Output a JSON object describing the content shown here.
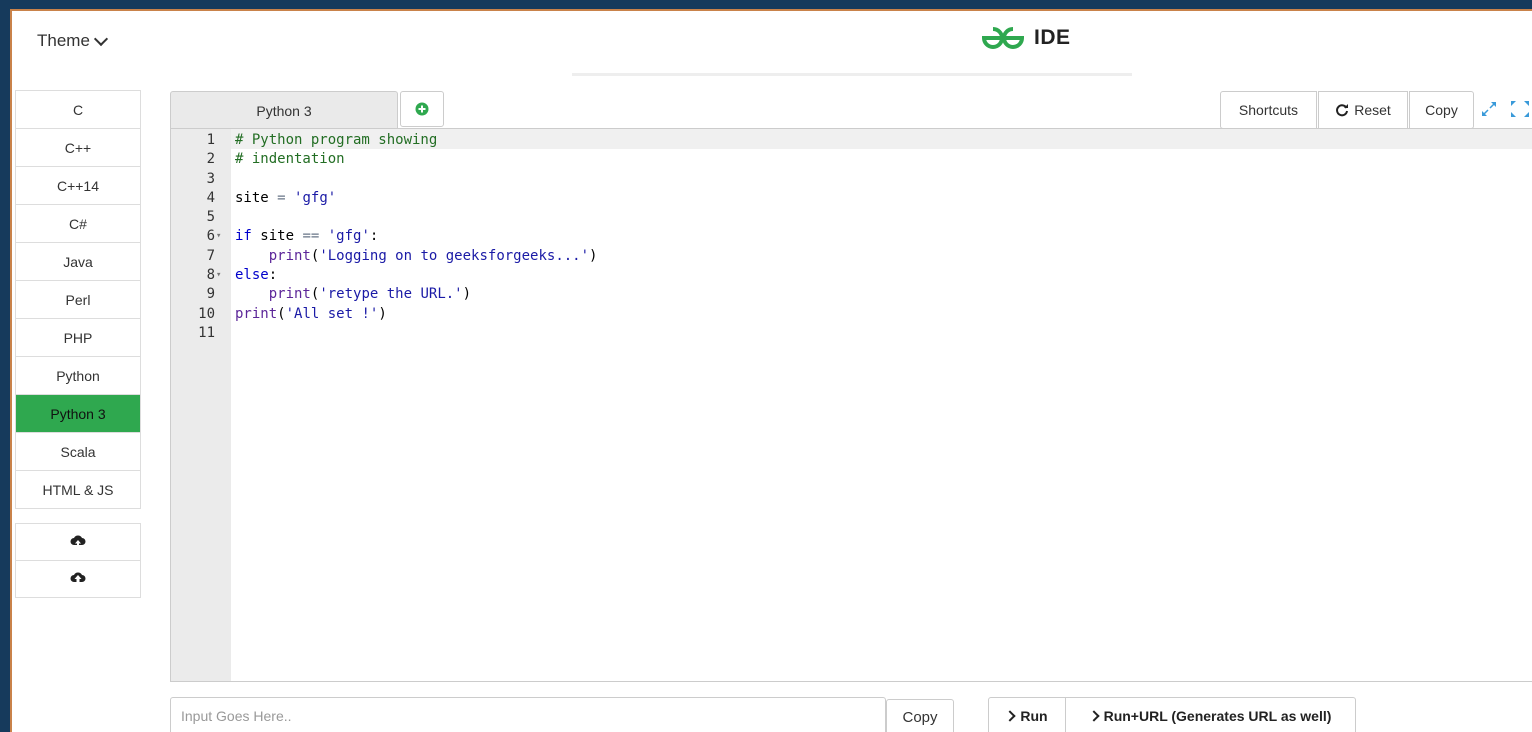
{
  "header": {
    "theme_label": "Theme",
    "logo_text": "IDE",
    "brand_color": "#2fa84f"
  },
  "sidebar": {
    "languages": [
      {
        "label": "C"
      },
      {
        "label": "C++"
      },
      {
        "label": "C++14"
      },
      {
        "label": "C#"
      },
      {
        "label": "Java"
      },
      {
        "label": "Perl"
      },
      {
        "label": "PHP"
      },
      {
        "label": "Python"
      },
      {
        "label": "Python 3",
        "active": true
      },
      {
        "label": "Scala"
      },
      {
        "label": "HTML & JS"
      }
    ],
    "cloud_buttons": [
      {
        "icon": "cloud-upload-icon"
      },
      {
        "icon": "cloud-download-icon"
      }
    ]
  },
  "editor_toolbar": {
    "tab_label": "Python 3",
    "shortcuts_label": "Shortcuts",
    "reset_label": "Reset",
    "copy_label": "Copy"
  },
  "editor": {
    "lines": [
      {
        "n": "1",
        "text": "# Python program showing"
      },
      {
        "n": "2",
        "text": "# indentation"
      },
      {
        "n": "3",
        "text": ""
      },
      {
        "n": "4",
        "text": "site = 'gfg'"
      },
      {
        "n": "5",
        "text": ""
      },
      {
        "n": "6",
        "text": "if site == 'gfg':",
        "fold": true
      },
      {
        "n": "7",
        "text": "    print('Logging on to geeksforgeeks...')"
      },
      {
        "n": "8",
        "text": "else:",
        "fold": true
      },
      {
        "n": "9",
        "text": "    print('retype the URL.')"
      },
      {
        "n": "10",
        "text": "print('All set !')"
      },
      {
        "n": "11",
        "text": ""
      }
    ]
  },
  "bottom": {
    "input_placeholder": "Input Goes Here..",
    "copy_label": "Copy",
    "run_label": "Run",
    "run_url_label": "Run+URL (Generates URL as well)"
  }
}
